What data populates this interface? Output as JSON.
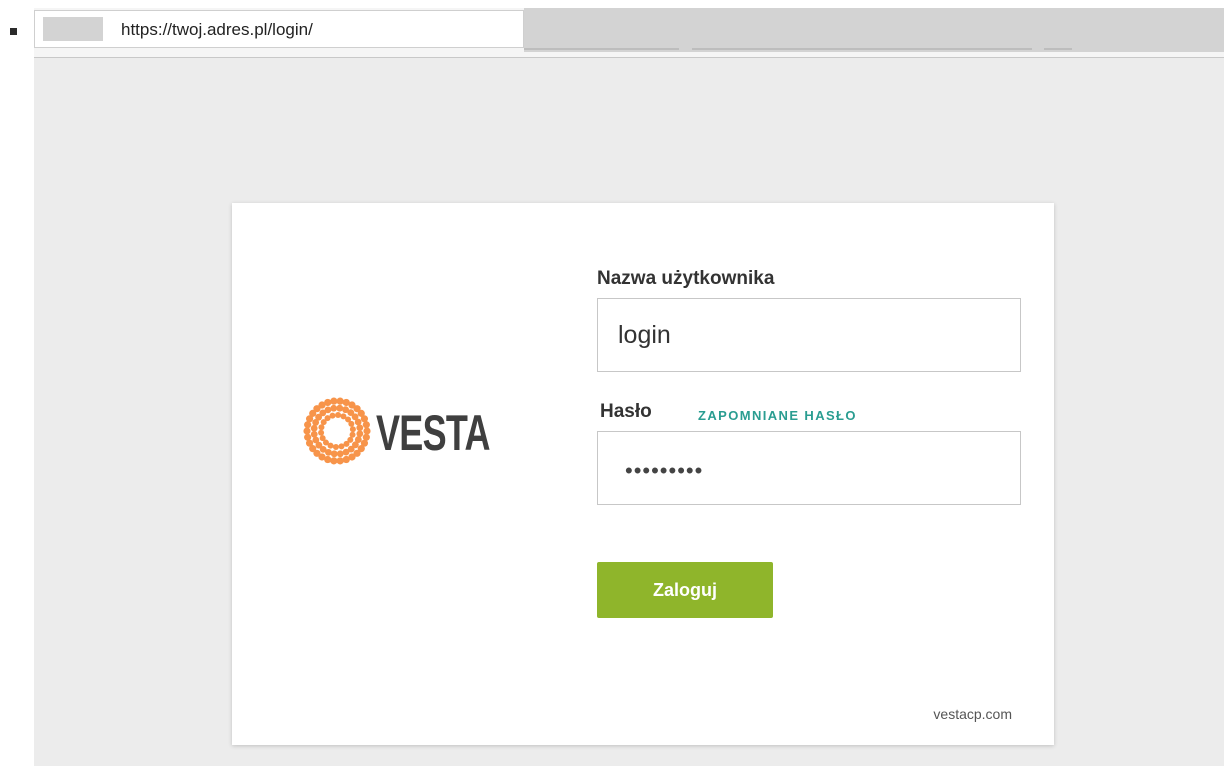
{
  "browser": {
    "url": "https://twoj.adres.pl/login/"
  },
  "login_card": {
    "logo_text": "VESTA",
    "username_label": "Nazwa użytkownika",
    "username_value": "login",
    "password_label": "Hasło",
    "forgot_password_link": "ZAPOMNIANE HASŁO",
    "password_value": "•••••••••",
    "submit_label": "Zaloguj",
    "footer_link": "vestacp.com"
  },
  "colors": {
    "accent_orange": "#f7944a",
    "button_green": "#8fb52b",
    "link_teal": "#2a9d91",
    "page_background": "#ececec"
  },
  "icons": {
    "logo": "vesta-ring-icon"
  }
}
